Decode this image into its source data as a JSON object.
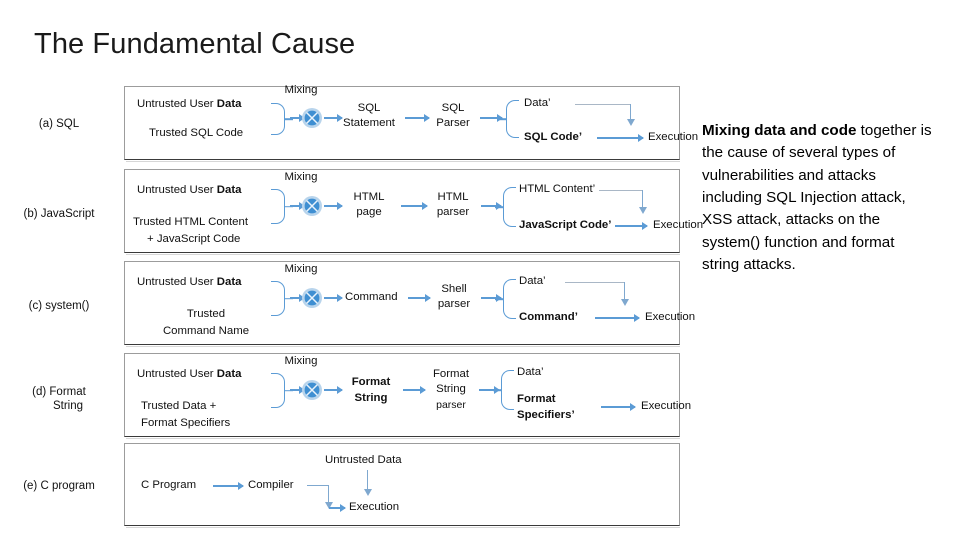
{
  "slide": {
    "title": "The Fundamental Cause",
    "background_color": "#ffffff",
    "accent_color": "#5b9bd5",
    "feedback_line_color": "#a9b7c6"
  },
  "commentary": {
    "lead": "Mixing data and code",
    "rest": " together is the cause of several types of vulnerabilities and attacks including SQL Injection attack, XSS attack, attacks on the system() function and format string attacks."
  },
  "figure": {
    "mixing_label": "Mixing",
    "execution_label": "Execution",
    "rows": [
      {
        "label": "(a) SQL",
        "input_top": "Untrusted User ",
        "input_top_bold": "Data",
        "input_bottom": "Trusted SQL Code",
        "mixed": "SQL\nStatement",
        "parser": "SQL\nParser",
        "out_top": "Data’",
        "out_bottom": "SQL Code’",
        "execution": "Execution"
      },
      {
        "label": "(b) JavaScript",
        "input_top": "Untrusted User ",
        "input_top_bold": "Data",
        "input_bottom": "Trusted HTML Content\n+ JavaScript Code",
        "mixed": "HTML\npage",
        "parser": "HTML\nparser",
        "out_top": "HTML Content’",
        "out_bottom": "JavaScript Code’",
        "execution": "Execution"
      },
      {
        "label": "(c) system()",
        "input_top": "Untrusted User ",
        "input_top_bold": "Data",
        "input_bottom": "Trusted\nCommand Name",
        "mixed": "Command",
        "parser": "Shell\nparser",
        "out_top": "Data’",
        "out_bottom": "Command’",
        "execution": "Execution"
      },
      {
        "label": "(d) Format\nString",
        "input_top": "Untrusted User ",
        "input_top_bold": "Data",
        "input_bottom": "Trusted Data +\nFormat Specifiers",
        "mixed": "Format\nString",
        "parser": "Format\nString\nparser",
        "out_top": "Data’",
        "out_bottom": "Format\nSpecifiers’",
        "execution": "Execution"
      }
    ],
    "row_e": {
      "label": "(e) C program",
      "source": "C Program",
      "compiler": "Compiler",
      "untrusted": "Untrusted Data",
      "execution": "Execution"
    }
  }
}
